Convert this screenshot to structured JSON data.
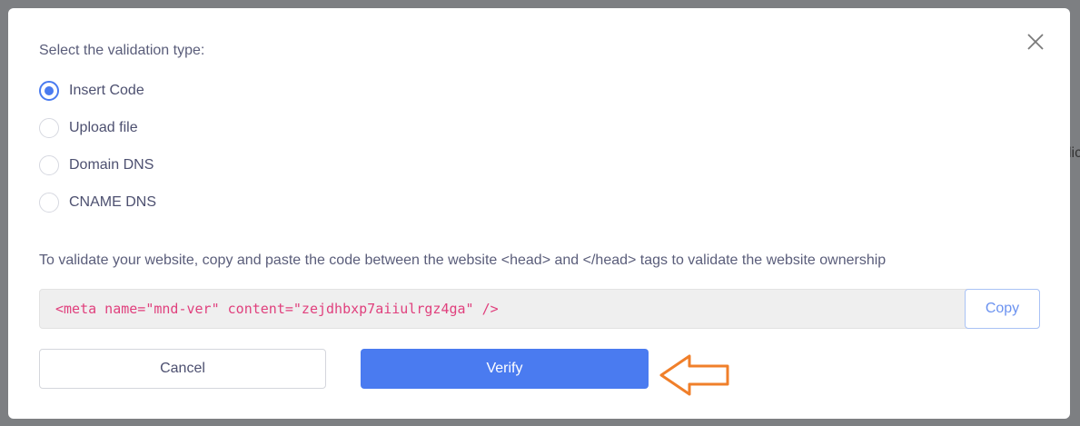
{
  "background": {
    "partial_text": "lic"
  },
  "modal": {
    "heading": "Select the validation type:",
    "validation_types": [
      {
        "label": "Insert Code",
        "checked": true
      },
      {
        "label": "Upload file",
        "checked": false
      },
      {
        "label": "Domain DNS",
        "checked": false
      },
      {
        "label": "CNAME DNS",
        "checked": false
      }
    ],
    "instruction": "To validate your website, copy and paste the code between the website <head> and </head> tags to validate the website ownership",
    "code": "<meta name=\"mnd-ver\" content=\"zejdhbxp7aiiulrgz4ga\" />",
    "copy_label": "Copy",
    "cancel_label": "Cancel",
    "verify_label": "Verify"
  },
  "colors": {
    "accent": "#4a7bf0",
    "code_text": "#e0407d",
    "annotation_arrow": "#f07f2a"
  },
  "icons": {
    "close": "close-icon",
    "arrow": "arrow-left-outline-icon"
  }
}
